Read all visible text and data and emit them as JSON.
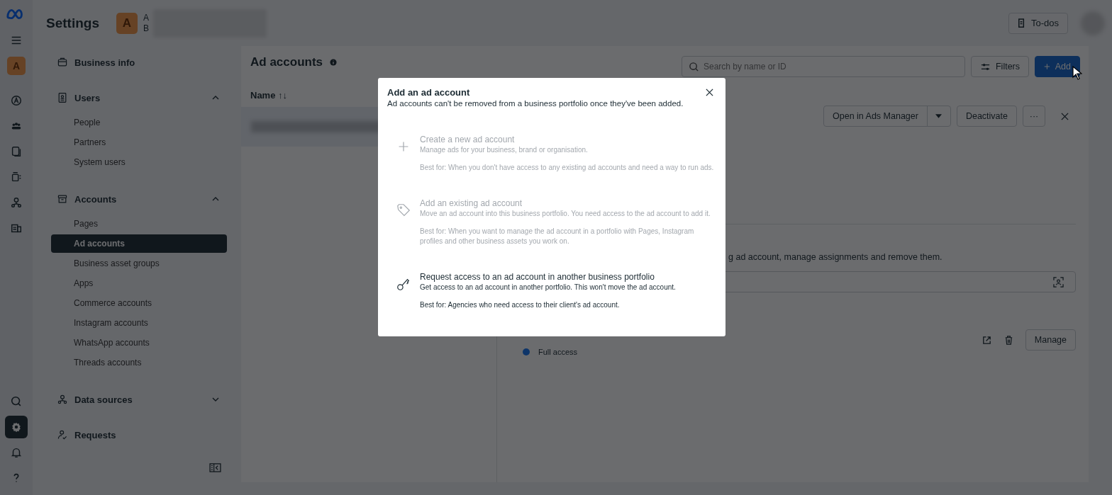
{
  "rail": {
    "avatar": "A",
    "top_items": [
      {
        "selected": false
      },
      {
        "selected": false
      },
      {
        "selected": false
      },
      {
        "selected": false
      },
      {
        "selected": false
      },
      {
        "selected": false
      }
    ],
    "bottom_items": [
      {
        "selected": false
      },
      {
        "selected": true
      },
      {
        "selected": false
      },
      {
        "selected": false
      }
    ]
  },
  "header": {
    "title": "Settings",
    "avatar": "A",
    "name_line_1": "A",
    "name_line_2": "B",
    "todos_button": "To-dos"
  },
  "sidebar": {
    "sections": [
      {
        "label": "Business info"
      },
      {
        "label": "Users",
        "expanded": true,
        "children": [
          {
            "label": "People",
            "selected": false
          },
          {
            "label": "Partners",
            "selected": false
          },
          {
            "label": "System users",
            "selected": false
          }
        ]
      },
      {
        "label": "Accounts",
        "expanded": true,
        "children": [
          {
            "label": "Pages",
            "selected": false
          },
          {
            "label": "Ad accounts",
            "selected": true
          },
          {
            "label": "Business asset groups",
            "selected": false
          },
          {
            "label": "Apps",
            "selected": false
          },
          {
            "label": "Commerce accounts",
            "selected": false
          },
          {
            "label": "Instagram accounts",
            "selected": false
          },
          {
            "label": "WhatsApp accounts",
            "selected": false
          },
          {
            "label": "Threads accounts",
            "selected": false
          }
        ]
      },
      {
        "label": "Data sources",
        "expanded": false
      },
      {
        "label": "Requests"
      }
    ]
  },
  "panel": {
    "title": "Ad accounts",
    "search": {
      "placeholder": "Search by name or ID"
    },
    "filters_button": "Filters",
    "add_button": "Add",
    "sort_column": "Name ↑↓",
    "detail": {
      "open_button": "Open in Ads Manager",
      "deactivate_button": "Deactivate",
      "more_button": "···",
      "description_tail": "g ad account, manage assignments and remove them.",
      "access_label": "Full access",
      "manage_button": "Manage"
    }
  },
  "modal": {
    "title": "Add an ad account",
    "subtitle": "Ad accounts can't be removed from a business portfolio once they've been added.",
    "options": [
      {
        "title": "Create a new ad account",
        "description": "Manage ads for your business, brand or organisation.",
        "best_for": "Best for: When you don't have access to any existing ad accounts and need a way to run ads.",
        "disabled": true
      },
      {
        "title": "Add an existing ad account",
        "description": "Move an ad account into this business portfolio. You need access to the ad account to add it.",
        "best_for": "Best for: When you want to manage the ad account in a portfolio with Pages, Instagram profiles and other business assets you work on.",
        "disabled": true
      },
      {
        "title": "Request access to an ad account in another business portfolio",
        "description": "Get access to an ad account in another portfolio. This won't move the ad account.",
        "best_for": "Best for: Agencies who need access to their client's ad account.",
        "disabled": false
      }
    ]
  }
}
